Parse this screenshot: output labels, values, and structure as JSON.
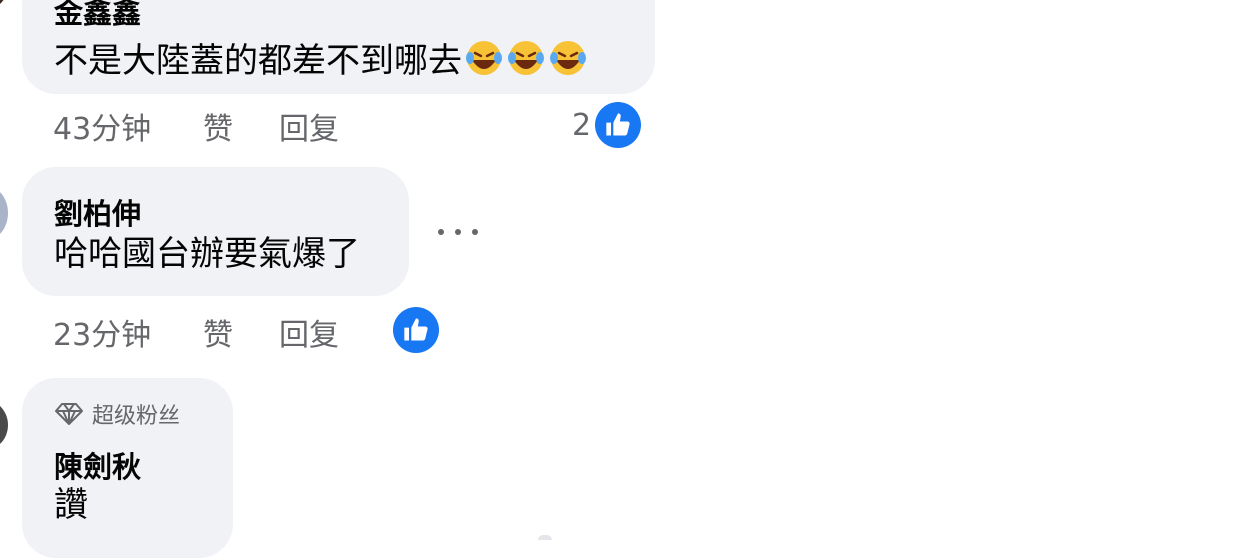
{
  "colors": {
    "bubble_bg": "#f0f2f5",
    "meta_text": "#65676b",
    "like_blue": "#1877f2"
  },
  "comments": [
    {
      "author": "金鑫鑫",
      "text": "不是大陸蓋的都差不到哪去",
      "emoji": [
        "rolling-on-floor-laughing",
        "rolling-on-floor-laughing",
        "rolling-on-floor-laughing"
      ],
      "time": "43分钟",
      "like_label": "赞",
      "reply_label": "回复",
      "reaction_count": "2",
      "reaction_icon": "like-icon"
    },
    {
      "author": "劉柏伸",
      "text": "哈哈國台辦要氣爆了",
      "time": "23分钟",
      "like_label": "赞",
      "reply_label": "回复",
      "reaction_count": "",
      "reaction_icon": "like-icon",
      "more_icon": "more-options-icon"
    },
    {
      "badge_icon": "diamond-icon",
      "badge": "超级粉丝",
      "author": "陳劍秋",
      "text": "讚"
    }
  ]
}
